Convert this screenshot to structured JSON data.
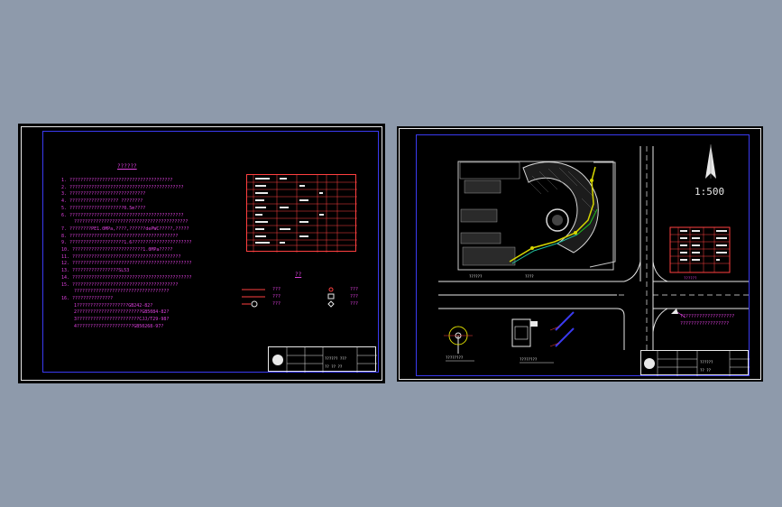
{
  "sheet1": {
    "notes_title": "??????",
    "notes": [
      "1. ??????????????????????????????????????",
      "2. ??????????????????????????????????????????",
      "3. ????????????????????????????",
      "4. ?????????????????? ????????",
      "5. ????????????????????0.5m????",
      "6. ??????????????????????????????????????????",
      "  ??????????????????????????????????????????",
      "7. ????????PE1.0MPa,????,??????dePWC?????,?????",
      "8. ????????????????????????????????????????",
      "9. ????????????????????1.6??????????????????????",
      "10. ??????????????????????????1.0MPa?????",
      "11. ????????????????????????????????????????",
      "12. ????????????????????????????????????????????",
      "13. ?????????????????SL53",
      "14. ????????????????????????????????????????????",
      "15. ???????????????????????????????????????",
      "  ???????????????????????????????????",
      "16. ???????????????",
      "  1???????????????????GB242-82?",
      "  2????????????????????????GB5084-82?",
      "  3???????????????????????CJJ/T29-98?",
      "  4?????????????????????GB50268-97?"
    ],
    "legend_title": "??",
    "legend_items": [
      "???",
      "???",
      "???",
      "???",
      "???",
      "???"
    ],
    "title_block": {
      "col1": [
        "??",
        "??",
        "??"
      ],
      "col2": [
        "??",
        "??",
        "??"
      ],
      "drawing": "??????  ???",
      "label": "?? ??  ??"
    }
  },
  "sheet2": {
    "scale_label": "1:500",
    "north_label": "N",
    "road_labels": [
      "??????",
      "????",
      "??????"
    ],
    "detail_labels": [
      "????????",
      "????????"
    ],
    "annotation_notes": [
      "????????????????????",
      "??????????????????"
    ],
    "title_block": {
      "col1": [
        "??",
        "??",
        "??"
      ],
      "drawing": "??????",
      "label": "?? ??"
    }
  }
}
